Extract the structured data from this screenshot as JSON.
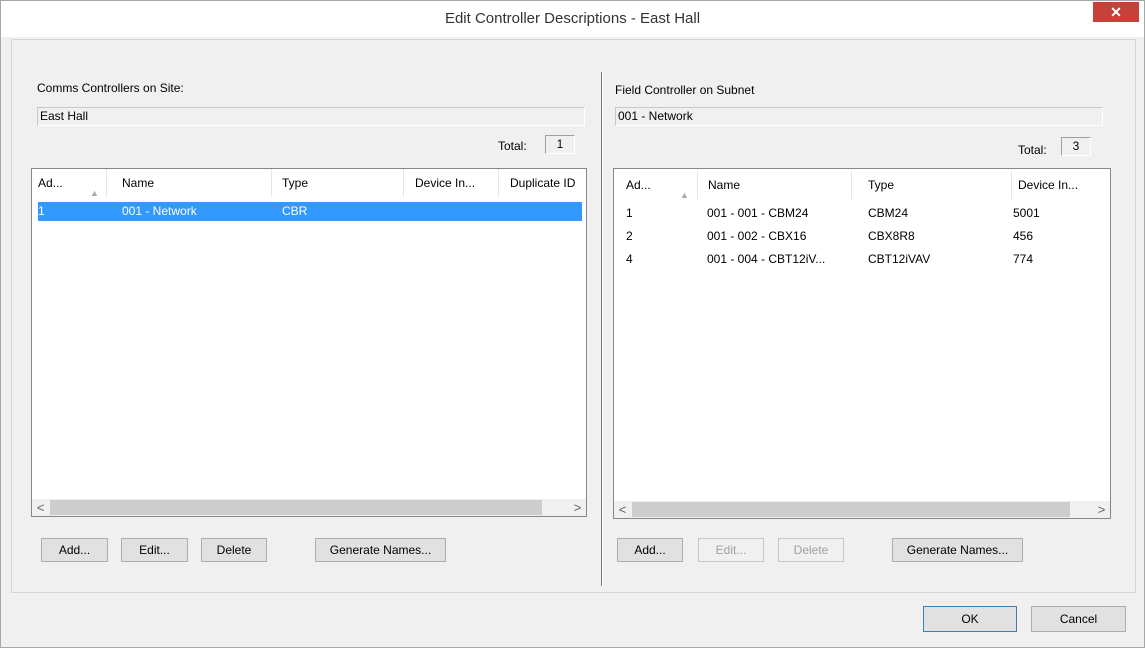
{
  "window": {
    "title": "Edit Controller Descriptions - East Hall",
    "close_glyph": "✕"
  },
  "left": {
    "section_label": "Comms Controllers on Site:",
    "field_value": "East Hall",
    "total_label": "Total:",
    "total_value": "1",
    "columns": [
      "Ad...",
      "Name",
      "Type",
      "Device In...",
      "Duplicate ID"
    ],
    "rows": [
      {
        "address": "1",
        "name": "001 - Network",
        "type": "CBR",
        "device": "",
        "duplicate": "",
        "selected": true
      }
    ],
    "buttons": {
      "add": "Add...",
      "edit": "Edit...",
      "delete": "Delete",
      "generate": "Generate Names..."
    }
  },
  "right": {
    "section_label": "Field Controller on Subnet",
    "field_value": "001 - Network",
    "total_label": "Total:",
    "total_value": "3",
    "columns": [
      "Ad...",
      "Name",
      "Type",
      "Device In..."
    ],
    "rows": [
      {
        "address": "1",
        "name": "001 - 001 - CBM24",
        "type": "CBM24",
        "device": "5001"
      },
      {
        "address": "2",
        "name": "001 - 002 - CBX16",
        "type": "CBX8R8",
        "device": "456"
      },
      {
        "address": "4",
        "name": "001 - 004 - CBT12iV...",
        "type": "CBT12iVAV",
        "device": "774"
      }
    ],
    "buttons": {
      "add": "Add...",
      "edit": "Edit...",
      "delete": "Delete",
      "generate": "Generate Names..."
    }
  },
  "footer": {
    "ok": "OK",
    "cancel": "Cancel"
  },
  "glyphs": {
    "sort": "▲",
    "left_arrow": "<",
    "right_arrow": ">"
  },
  "colors": {
    "selection": "#3399ff",
    "close_button": "#c7413a"
  }
}
